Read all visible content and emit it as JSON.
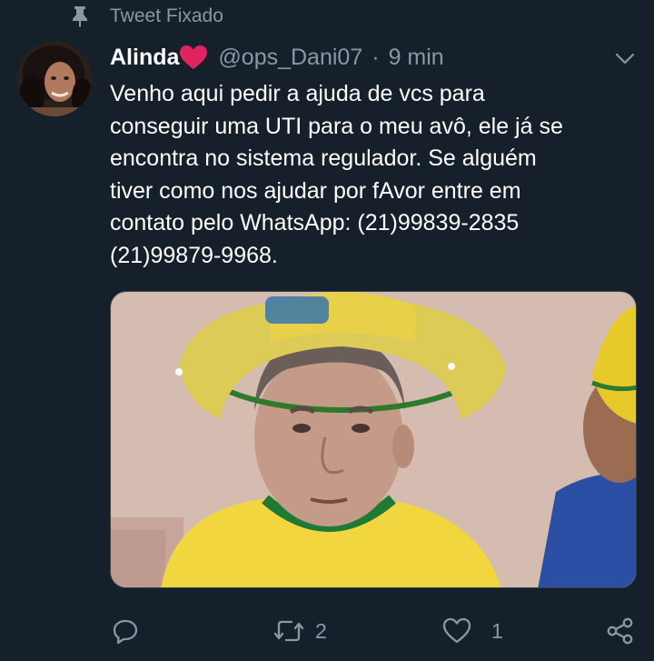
{
  "pinned": {
    "label": "Tweet Fixado",
    "icon": "pin-icon"
  },
  "author": {
    "name": "Alinda",
    "emoji_icon": "red-heart-icon",
    "handle": "@ops_Dani07",
    "separator": "·",
    "time": "9 min"
  },
  "tweet": {
    "lines": [
      "Venho aqui pedir a ajuda de vcs para",
      "conseguir uma UTI para o meu avô, ele já se",
      "encontra no sistema regulador. Se alguém",
      "tiver como nos ajudar por fAvor entre em",
      "contato pelo WhatsApp: (21)99839-2835",
      "(21)99879-9968."
    ]
  },
  "actions": {
    "reply": {
      "icon": "reply-icon",
      "count": ""
    },
    "retweet": {
      "icon": "retweet-icon",
      "count": "2"
    },
    "like": {
      "icon": "heart-outline-icon",
      "count": "1"
    },
    "share": {
      "icon": "share-icon"
    }
  },
  "colors": {
    "background": "#15202b",
    "text": "#ffffff",
    "muted": "#8899a6",
    "heart": "#e0245e"
  }
}
